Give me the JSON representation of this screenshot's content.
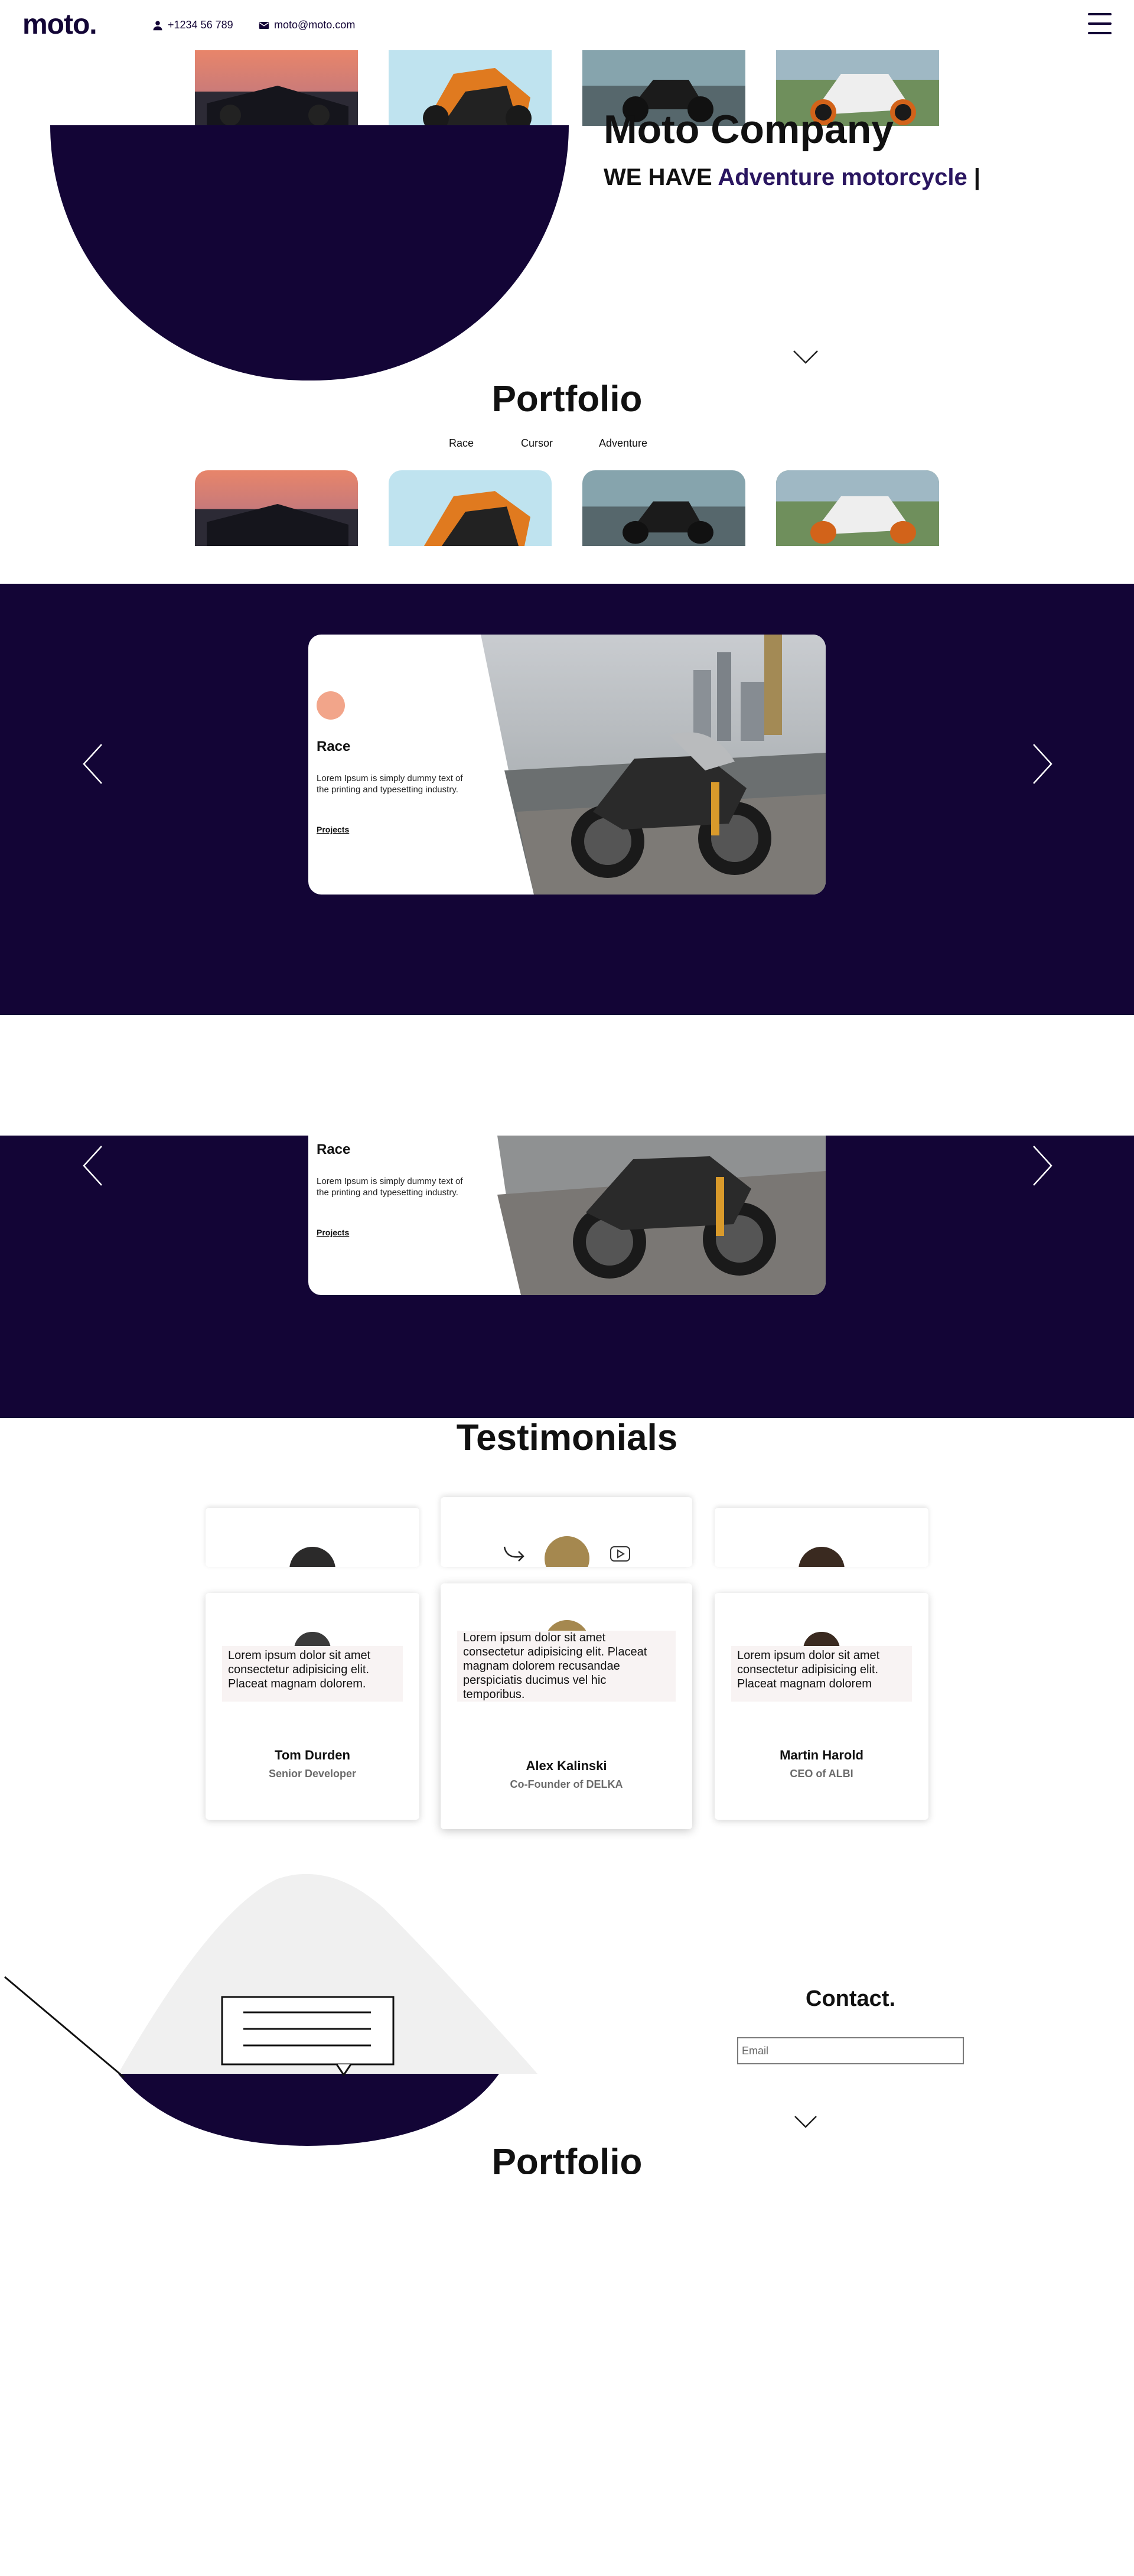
{
  "header": {
    "logo": "moto.",
    "phone": "+1234 56 789",
    "email": "moto@moto.com",
    "icons": [
      "person-icon",
      "mail-icon",
      "menu-icon"
    ]
  },
  "hero": {
    "title": "Moto Company",
    "subtitle_prefix": "WE HAVE ",
    "subtitle_accent": "Adventure motorcycle",
    "subtitle_cursor": " |"
  },
  "portfolio": {
    "title": "Portfolio",
    "filters": [
      "Race",
      "Cursor",
      "Adventure"
    ]
  },
  "slider_top": {
    "card_title": "Race",
    "card_text": "Lorem Ipsum is simply dummy text of the printing and typesetting industry.",
    "card_link": "Projects"
  },
  "slider_bottom": {
    "card_title": "Race",
    "card_text": "Lorem Ipsum is simply dummy text of the printing and typesetting industry.",
    "card_link": "Projects"
  },
  "testimonials": {
    "title": "Testimonials",
    "cards": [
      {
        "quote": "Lorem ipsum dolor sit amet consectetur adipisicing elit. Placeat magnam dolorem.",
        "name": "Tom Durden",
        "role": "Senior Developer"
      },
      {
        "quote": "Lorem ipsum dolor sit amet consectetur adipisicing elit. Placeat magnam dolorem recusandae perspiciatis ducimus vel hic temporibus.",
        "name": "Alex Kalinski",
        "role": "Co-Founder of DELKA"
      },
      {
        "quote": "Lorem ipsum dolor sit amet consectetur adipisicing elit. Placeat magnam dolorem",
        "name": "Martin Harold",
        "role": "CEO of ALBI"
      }
    ]
  },
  "contact": {
    "title": "Contact.",
    "email_placeholder": "Email"
  },
  "footer_peek": {
    "title": "Portfolio"
  },
  "colors": {
    "navy": "#130536",
    "accent_purple": "#2a1660",
    "peach": "#f2a58a",
    "light_gray": "#f0f0f0"
  }
}
